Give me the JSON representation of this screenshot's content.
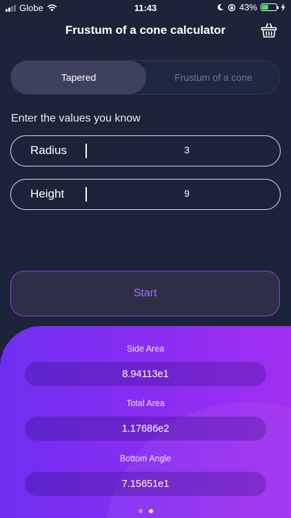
{
  "status_bar": {
    "carrier": "Globe",
    "time": "11:43",
    "battery_percent": "43%",
    "battery_level": 0.43
  },
  "header": {
    "title": "Frustum of a cone calculator",
    "icon": "basket-icon"
  },
  "tabs": [
    {
      "label": "Tapered",
      "active": true
    },
    {
      "label": "Frustum of a cone",
      "active": false
    }
  ],
  "form": {
    "prompt": "Enter the values you know",
    "fields": [
      {
        "label": "Radius",
        "value": "3"
      },
      {
        "label": "Height",
        "value": "9"
      }
    ],
    "start_label": "Start"
  },
  "results": [
    {
      "label": "Side Area",
      "value": "8.94113e1"
    },
    {
      "label": "Total Area",
      "value": "1.17686e2"
    },
    {
      "label": "Bottom Angle",
      "value": "7.15651e1"
    }
  ],
  "pager": {
    "pages": 2,
    "active_index": 1
  },
  "colors": {
    "background": "#1b2438",
    "accent": "#8a3ff0",
    "results_gradient_start": "#6e2ff0",
    "results_gradient_end": "#a22ff2"
  }
}
